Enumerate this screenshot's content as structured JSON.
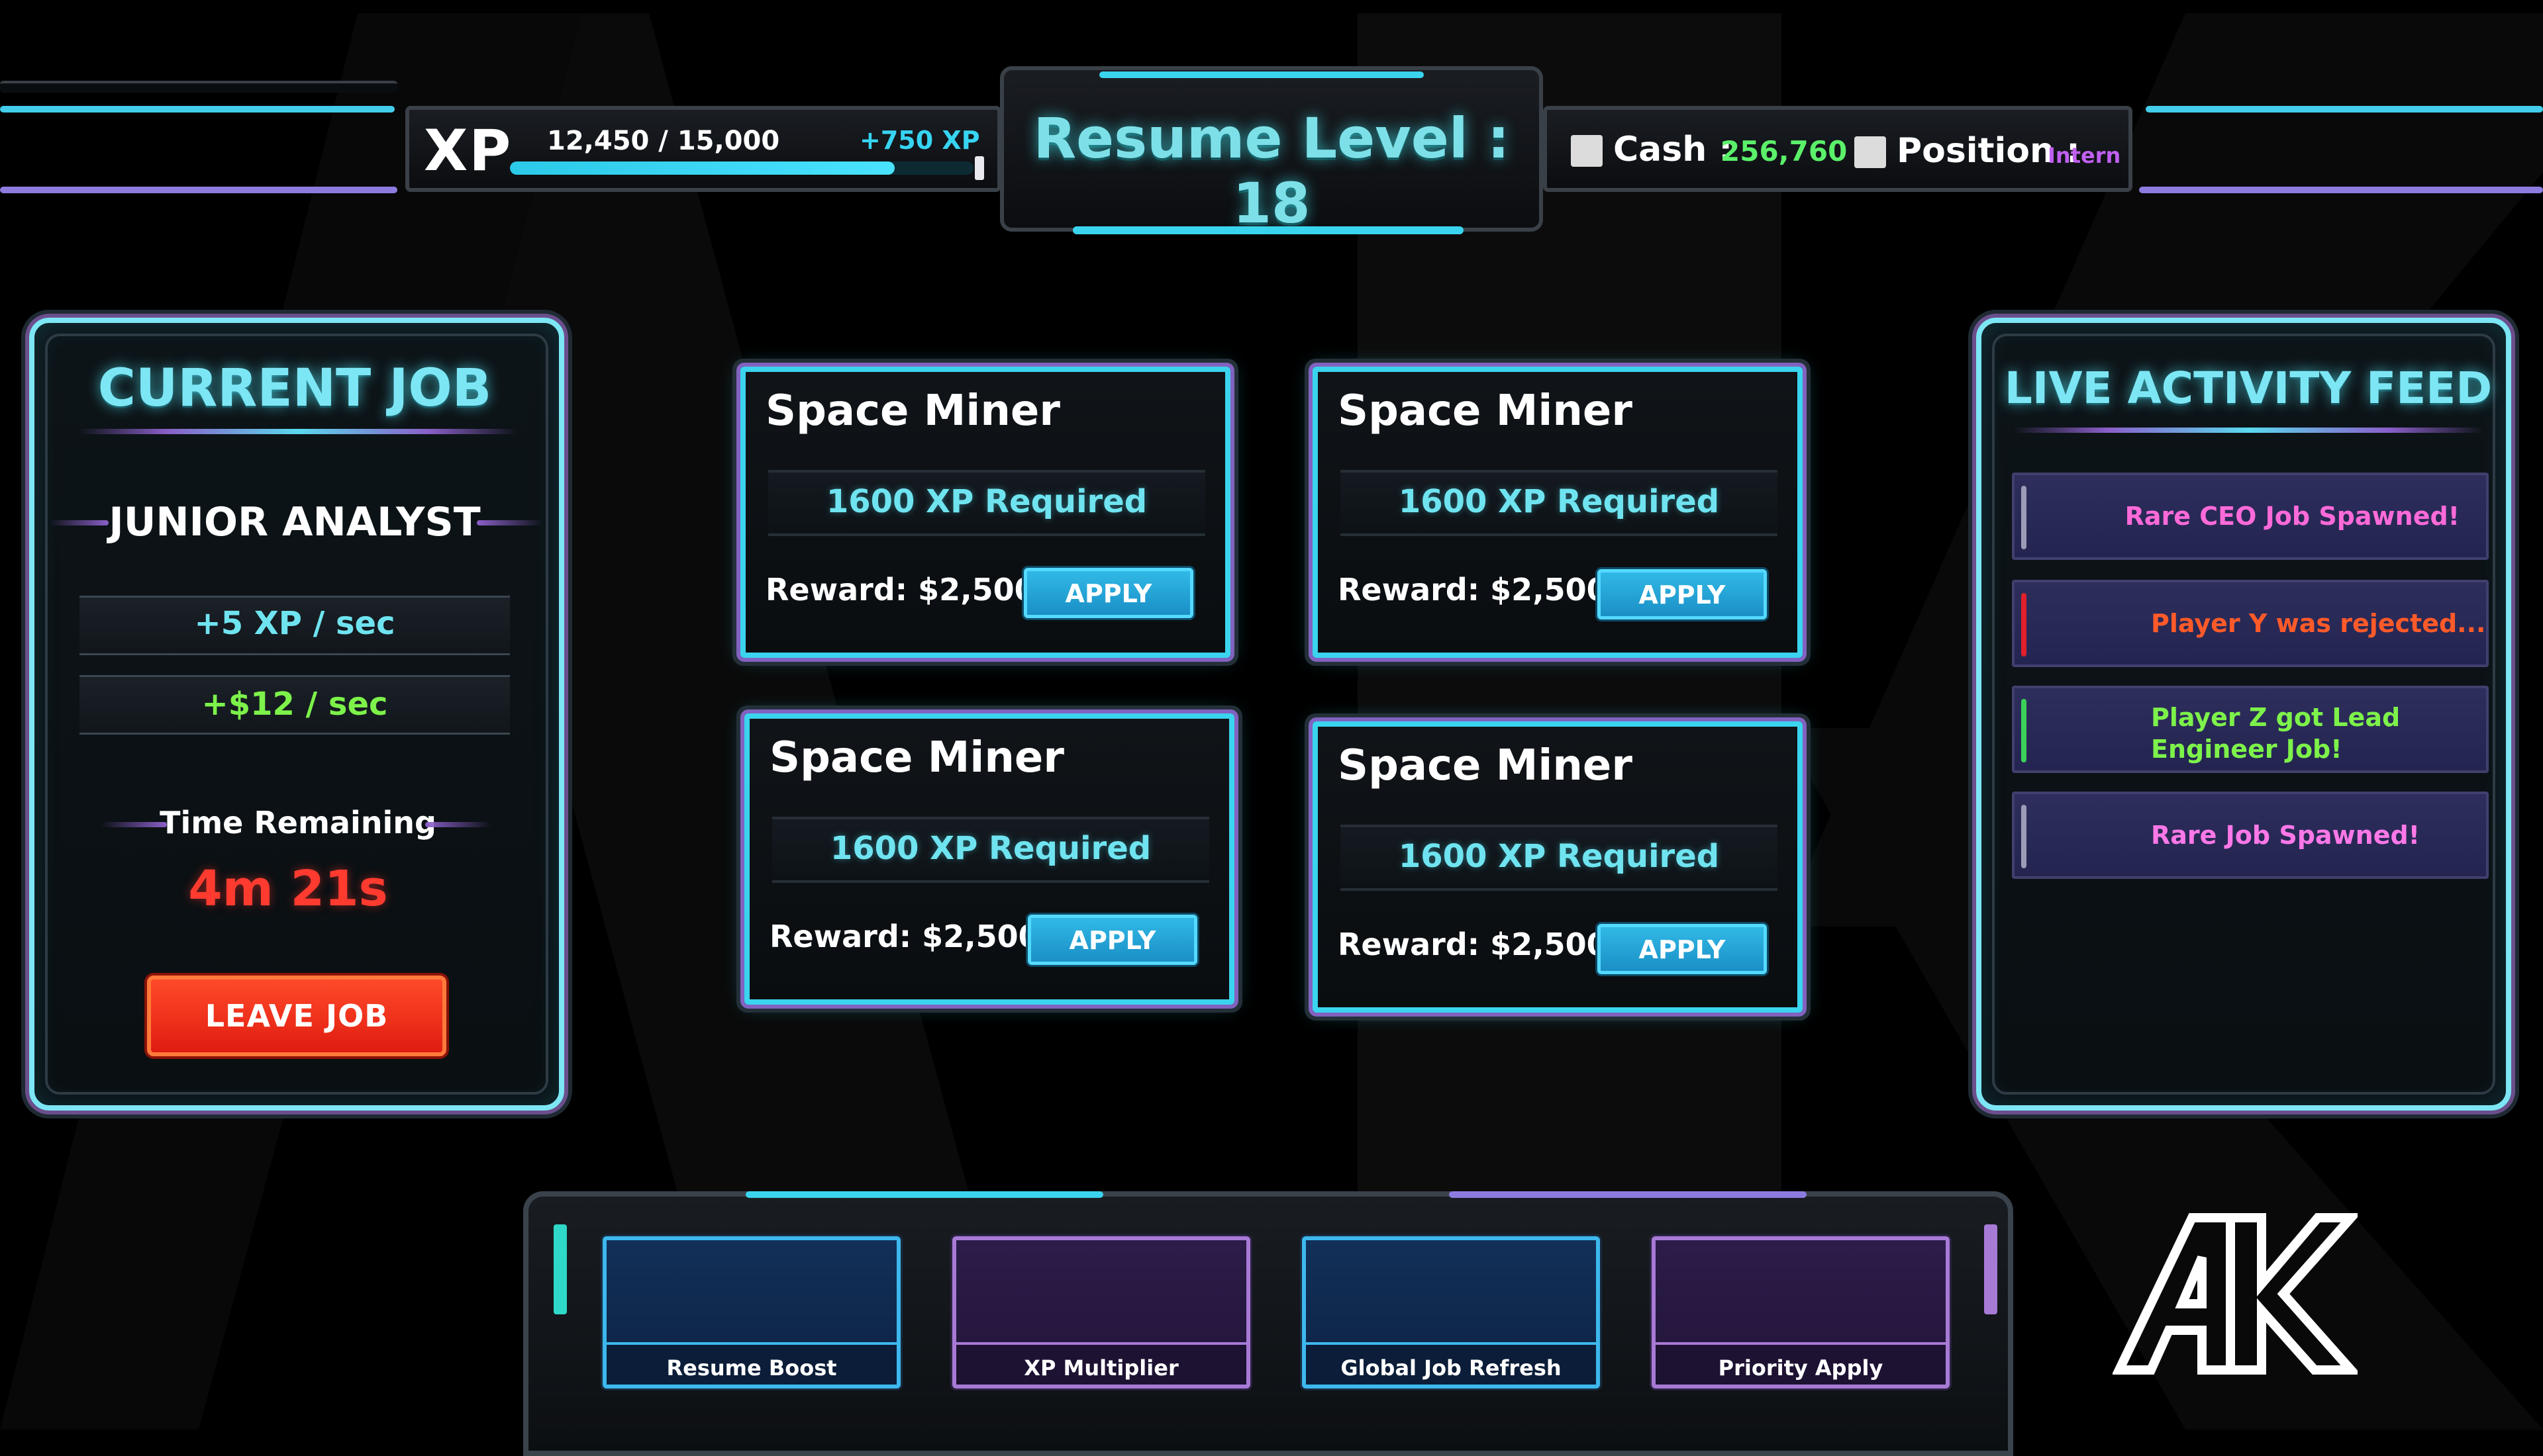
{
  "hud": {
    "xp_label": "XP",
    "xp_value_text": "12,450 / 15,000",
    "xp_gain": "+750 XP",
    "xp_progress": 0.83,
    "level_text": "Resume Level :  18",
    "cash_label": "Cash :",
    "cash_value": "256,760",
    "position_label": "Position :",
    "position_value": "Intern"
  },
  "current_job": {
    "title": "CURRENT JOB",
    "job_name": "JUNIOR ANALYST",
    "xp_rate": "+5 XP / sec",
    "cash_rate": "+$12 / sec",
    "time_label": "Time Remaining",
    "time_value": "4m 21s",
    "leave_button": "LEAVE JOB"
  },
  "jobs": [
    {
      "title": "Space Miner",
      "requirement": "1600 XP Required",
      "reward": "Reward: $2,500",
      "apply": "APPLY"
    },
    {
      "title": "Space Miner",
      "requirement": "1600 XP Required",
      "reward": "Reward: $2,500",
      "apply": "APPLY"
    },
    {
      "title": "Space Miner",
      "requirement": "1600 XP Required",
      "reward": "Reward: $2,500",
      "apply": "APPLY"
    },
    {
      "title": "Space Miner",
      "requirement": "1600 XP Required",
      "reward": "Reward: $2,500",
      "apply": "APPLY"
    }
  ],
  "feed": {
    "title": "LIVE ACTIVITY FEED",
    "items": [
      {
        "text": "Rare CEO Job Spawned!",
        "text_color": "#ff6ad9",
        "bar_color": "#9c9cb8"
      },
      {
        "text": "Player Y was rejected...",
        "text_color": "#ff5a2a",
        "bar_color": "#e0202a"
      },
      {
        "text_line1": "Player Z  got Lead",
        "text_line2": "Engineer Job!",
        "text_color": "#7df24a",
        "bar_color": "#3cd25a"
      },
      {
        "text": "Rare Job Spawned!",
        "text_color": "#ff78e8",
        "bar_color": "#9c9cb8"
      }
    ]
  },
  "boosts": [
    {
      "label": "Resume Boost",
      "style": "blue"
    },
    {
      "label": "XP Multiplier",
      "style": "purple"
    },
    {
      "label": "Global Job Refresh",
      "style": "blue"
    },
    {
      "label": "Priority Apply",
      "style": "purple"
    }
  ],
  "logo_text": "AK",
  "colors": {
    "accent_cyan": "#3ad4ee",
    "accent_purple": "#8262c0",
    "cash_green": "#5bf06a",
    "position_purple": "#c060f0",
    "danger_red": "#ff3b30"
  }
}
